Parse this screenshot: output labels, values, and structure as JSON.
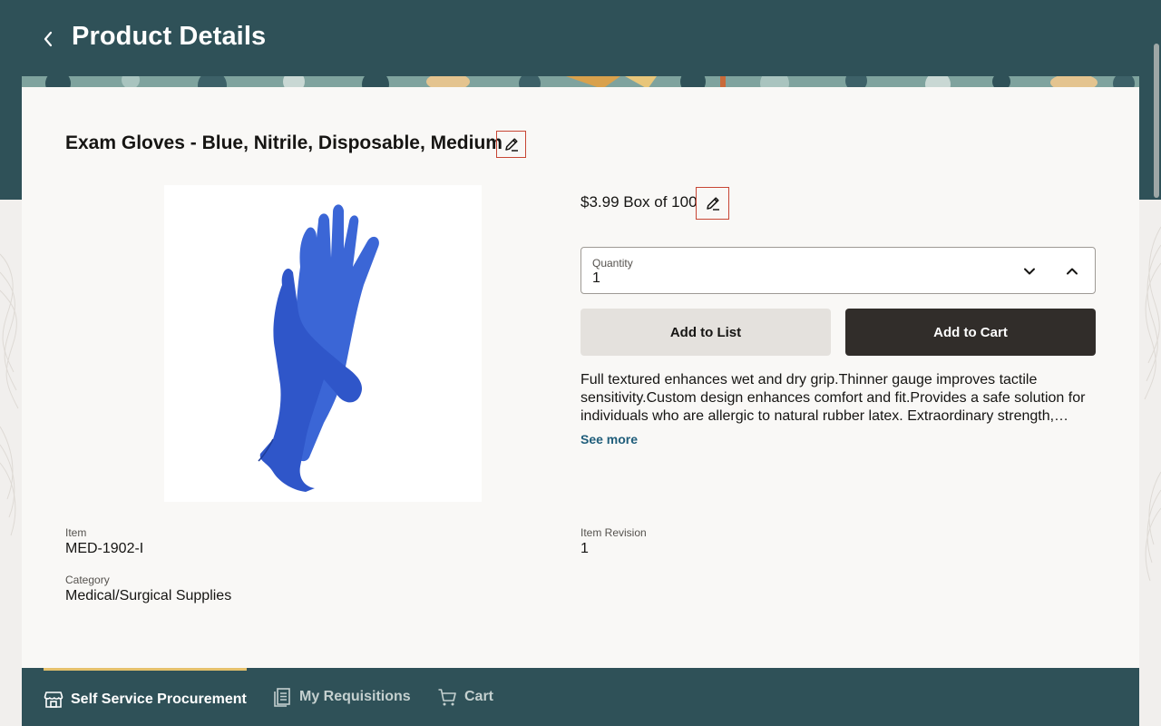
{
  "header": {
    "title": "Product Details",
    "back_icon": "chevron-left-icon"
  },
  "product": {
    "name": "Exam Gloves - Blue, Nitrile, Disposable, Medium",
    "price": "$3.99 Box of 100",
    "description": "Full textured enhances wet and dry grip.Thinner gauge improves tactile sensitivity.Custom design enhances comfort and fit.Provides a safe solution for individuals who are allergic to natural rubber latex. Extraordinary strength, puncture resistance and durability.",
    "see_more": "See more",
    "image_alt": "Blue nitrile exam gloves"
  },
  "quantity": {
    "label": "Quantity",
    "value": "1"
  },
  "actions": {
    "add_to_list": "Add to List",
    "add_to_cart": "Add to Cart"
  },
  "fields": {
    "item_label": "Item",
    "item_value": "MED-1902-I",
    "revision_label": "Item Revision",
    "revision_value": "1",
    "category_label": "Category",
    "category_value": "Medical/Surgical Supplies"
  },
  "bottom_nav": {
    "items": [
      {
        "label": "Self Service Procurement",
        "icon": "store-icon",
        "active": true
      },
      {
        "label": "My Requisitions",
        "icon": "requisitions-icon",
        "active": false
      },
      {
        "label": "Cart",
        "icon": "cart-icon",
        "active": false
      }
    ]
  },
  "colors": {
    "header_bg": "#2f5158",
    "card_bg": "#f9f8f6",
    "primary_button": "#312d2a",
    "secondary_button": "#e4e1dd",
    "link": "#1f5d7a",
    "edit_outline": "#c74634",
    "active_nav_indicator": "#e5c16c"
  }
}
